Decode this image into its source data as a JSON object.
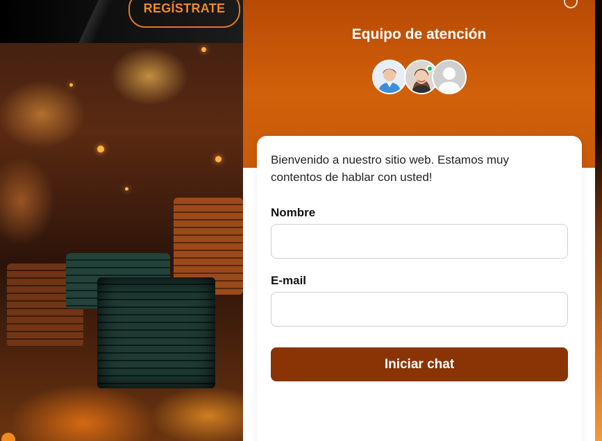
{
  "site": {
    "register_label": "REGÍSTRATE"
  },
  "chat": {
    "title": "Equipo de atención",
    "welcome": "Bienvenido a nuestro sitio web. Estamos muy contentos de hablar con usted!",
    "name_label": "Nombre",
    "name_value": "",
    "email_label": "E-mail",
    "email_value": "",
    "start_label": "Iniciar chat",
    "agents": [
      {
        "icon": "agent-male-avatar"
      },
      {
        "icon": "agent-female-avatar",
        "online": true
      },
      {
        "icon": "agent-placeholder-avatar"
      }
    ]
  },
  "colors": {
    "header": "#d1600a",
    "button": "#8a3406",
    "register_border": "#e07a1f"
  }
}
